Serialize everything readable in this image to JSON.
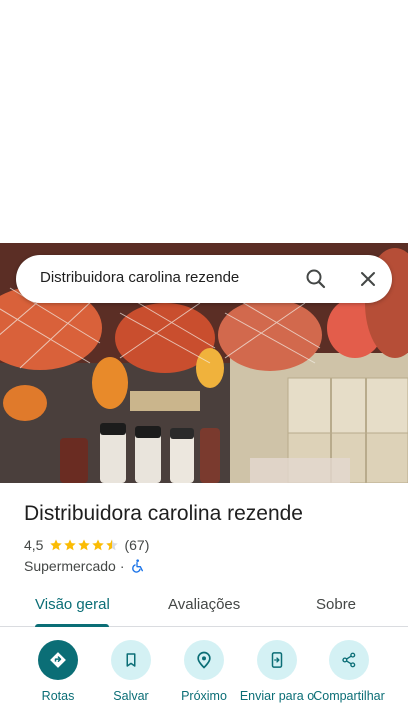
{
  "search": {
    "query": "Distribuidora carolina rezende"
  },
  "place": {
    "name": "Distribuidora carolina rezende",
    "rating_value": "4,5",
    "rating_stars": 4.5,
    "review_count": "(67)",
    "category": "Supermercado",
    "separator": "·",
    "accessibility_icon": "wheelchair-icon"
  },
  "tabs": [
    {
      "label": "Visão geral",
      "active": true
    },
    {
      "label": "Avaliações",
      "active": false
    },
    {
      "label": "Sobre",
      "active": false
    }
  ],
  "actions": [
    {
      "label": "Rotas",
      "icon": "directions-icon"
    },
    {
      "label": "Salvar",
      "icon": "bookmark-icon"
    },
    {
      "label": "Próximo",
      "icon": "nearby-icon"
    },
    {
      "label": "Enviar para o",
      "icon": "send-to-phone-icon"
    },
    {
      "label": "Compartilhar",
      "icon": "share-icon"
    }
  ],
  "colors": {
    "accent": "#0b6e76",
    "accent_light": "#d4f1f4",
    "star": "#fbbc04",
    "accessibility": "#1a73e8"
  }
}
